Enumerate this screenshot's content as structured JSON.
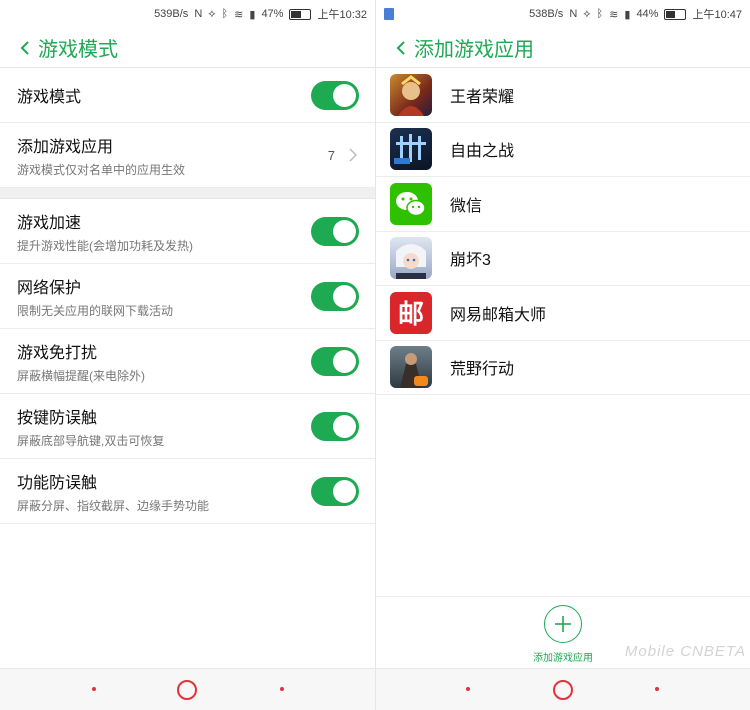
{
  "left": {
    "status": {
      "speed": "539B/s",
      "battery": "47%",
      "time": "上午10:32",
      "battery_level": 0.47
    },
    "title": "游戏模式",
    "rows": [
      {
        "title": "游戏模式",
        "subtitle": "",
        "toggle": true
      },
      {
        "title": "添加游戏应用",
        "subtitle": "游戏模式仅对名单中的应用生效",
        "count": "7"
      },
      {
        "title": "游戏加速",
        "subtitle": "提升游戏性能(会增加功耗及发热)",
        "toggle": true
      },
      {
        "title": "网络保护",
        "subtitle": "限制无关应用的联网下载活动",
        "toggle": true
      },
      {
        "title": "游戏免打扰",
        "subtitle": "屏蔽横幅提醒(来电除外)",
        "toggle": true
      },
      {
        "title": "按键防误触",
        "subtitle": "屏蔽底部导航键,双击可恢复",
        "toggle": true
      },
      {
        "title": "功能防误触",
        "subtitle": "屏蔽分屏、指纹截屏、边缘手势功能",
        "toggle": true
      }
    ]
  },
  "right": {
    "status": {
      "speed": "538B/s",
      "battery": "44%",
      "time": "上午10:47",
      "battery_level": 0.44
    },
    "title": "添加游戏应用",
    "apps": [
      {
        "name": "王者荣耀",
        "icon": "honor-of-kings-icon"
      },
      {
        "name": "自由之战",
        "icon": "freedom-battle-icon"
      },
      {
        "name": "微信",
        "icon": "wechat-icon"
      },
      {
        "name": "崩坏3",
        "icon": "honkai-3-icon"
      },
      {
        "name": "网易邮箱大师",
        "icon": "netease-mail-icon",
        "glyph": "邮"
      },
      {
        "name": "荒野行动",
        "icon": "knives-out-icon"
      }
    ],
    "add_label": "添加游戏应用",
    "watermark": "Mobile CNBETA"
  },
  "colors": {
    "accent": "#1fa855",
    "nav": "#e2323a"
  }
}
